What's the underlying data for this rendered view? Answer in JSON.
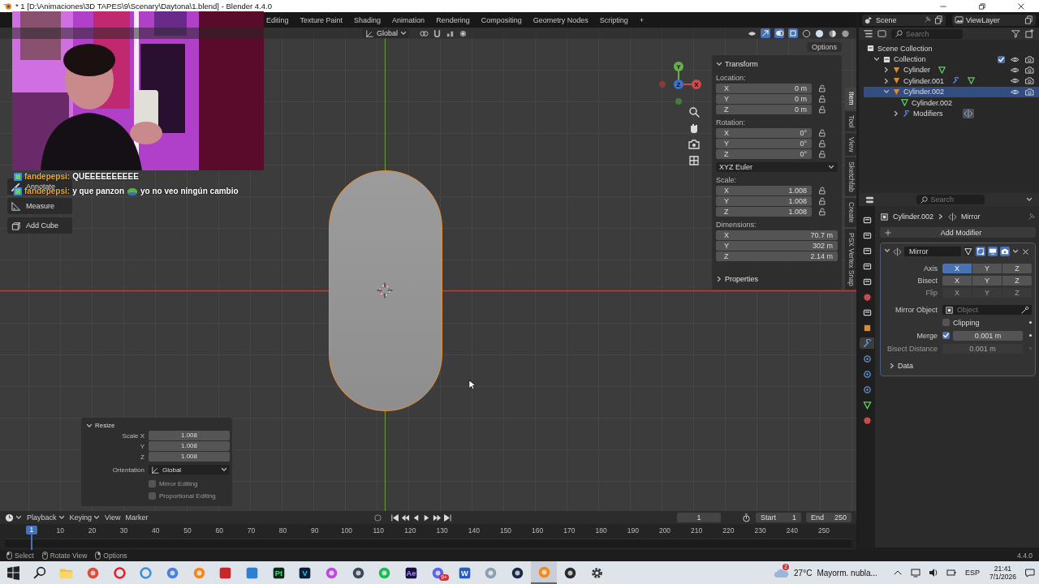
{
  "window": {
    "title": "* 1 [D:\\Animaciones\\3D TAPES\\9\\Scenary\\Daytona\\1.blend] - Blender 4.4.0"
  },
  "workspace_tabs": [
    {
      "label": "Editing"
    },
    {
      "label": "Texture Paint"
    },
    {
      "label": "Shading"
    },
    {
      "label": "Animation"
    },
    {
      "label": "Rendering"
    },
    {
      "label": "Compositing"
    },
    {
      "label": "Geometry Nodes"
    },
    {
      "label": "Scripting"
    },
    {
      "label": "+"
    }
  ],
  "scene": "Scene",
  "view_layer": "ViewLayer",
  "chat": [
    {
      "user": "fandepepsi:",
      "segments": [
        {
          "kind": "text",
          "text": "QUEEEEEEEEEE"
        }
      ]
    },
    {
      "user": "fandepepsi:",
      "segments": [
        {
          "kind": "text",
          "text": "y que panzon"
        },
        {
          "kind": "emote"
        },
        {
          "kind": "text",
          "text": "yo no veo ningún cambio"
        }
      ]
    }
  ],
  "viewport": {
    "orientation": "Global",
    "gizmo": {
      "x": "X",
      "y": "Y",
      "z": "Z"
    }
  },
  "toolbar": [
    {
      "label": "Annotate"
    },
    {
      "label": "Measure"
    },
    {
      "label": "Add Cube"
    }
  ],
  "n_panel": {
    "options": "Options",
    "tabs": [
      {
        "label": "Item",
        "selected": true
      },
      {
        "label": "Tool",
        "selected": false
      },
      {
        "label": "View",
        "selected": false
      },
      {
        "label": "Sketchfab",
        "selected": false
      },
      {
        "label": "Create",
        "selected": false
      },
      {
        "label": "PSX Vertex Snap",
        "selected": false
      }
    ],
    "transform": {
      "title": "Transform",
      "expanded": true,
      "items": [
        {
          "kind": "vector",
          "label": "Location:",
          "locks": true,
          "rows": [
            {
              "axis": "X",
              "value": "0 m"
            },
            {
              "axis": "Y",
              "value": "0 m"
            },
            {
              "axis": "Z",
              "value": "0 m"
            }
          ]
        },
        {
          "kind": "vector",
          "label": "Rotation:",
          "locks": true,
          "rows": [
            {
              "axis": "X",
              "value": "0°"
            },
            {
              "axis": "Y",
              "value": "0°"
            },
            {
              "axis": "Z",
              "value": "0°"
            }
          ]
        },
        {
          "kind": "dropdown",
          "value": "XYZ Euler"
        },
        {
          "kind": "vector",
          "label": "Scale:",
          "locks": true,
          "rows": [
            {
              "axis": "X",
              "value": "1.008"
            },
            {
              "axis": "Y",
              "value": "1.008"
            },
            {
              "axis": "Z",
              "value": "1.008"
            }
          ]
        },
        {
          "kind": "vector",
          "label": "Dimensions:",
          "locks": false,
          "rows": [
            {
              "axis": "X",
              "value": "70.7 m"
            },
            {
              "axis": "Y",
              "value": "302 m"
            },
            {
              "axis": "Z",
              "value": "2.14 m"
            }
          ]
        }
      ]
    },
    "properties": {
      "title": "Properties",
      "expanded": false
    }
  },
  "resize_panel": {
    "title": "Resize",
    "expanded": true,
    "fields": [
      {
        "label": "Scale X",
        "value": "1.008"
      },
      {
        "label": "Y",
        "value": "1.008"
      },
      {
        "label": "Z",
        "value": "1.008"
      }
    ],
    "orientation": {
      "label": "Orientation",
      "value": "Global"
    },
    "checks": [
      {
        "label": "Mirror Editing",
        "checked": false
      },
      {
        "label": "Proportional Editing",
        "checked": false
      }
    ]
  },
  "outliner": {
    "search_placeholder": "Search",
    "tree": [
      {
        "kind": "scene_collection",
        "label": "Scene Collection",
        "children": [
          {
            "kind": "collection",
            "label": "Collection",
            "expanded": true,
            "checked": true,
            "children": [
              {
                "kind": "object",
                "label": "Cylinder",
                "expanded": false,
                "selected": false,
                "modifier_icon": false
              },
              {
                "kind": "object",
                "label": "Cylinder.001",
                "expanded": false,
                "selected": false,
                "modifier_icon": true
              },
              {
                "kind": "object",
                "label": "Cylinder.002",
                "expanded": true,
                "selected": true,
                "modifier_icon": false,
                "children": [
                  {
                    "kind": "mesh",
                    "label": "Cylinder.002"
                  },
                  {
                    "kind": "modifiers",
                    "label": "Modifiers",
                    "expanded": false
                  }
                ]
              }
            ]
          }
        ]
      }
    ]
  },
  "properties": {
    "search_placeholder": "Search",
    "tabs": [
      {
        "kind": "tool",
        "selected": false
      },
      {
        "kind": "render",
        "selected": false
      },
      {
        "kind": "output",
        "selected": false
      },
      {
        "kind": "view_layer",
        "selected": false
      },
      {
        "kind": "scene",
        "selected": false
      },
      {
        "kind": "world",
        "selected": false
      },
      {
        "kind": "collection",
        "selected": false
      },
      {
        "kind": "object",
        "selected": false
      },
      {
        "kind": "modifier",
        "selected": true
      },
      {
        "kind": "particles",
        "selected": false
      },
      {
        "kind": "physics",
        "selected": false
      },
      {
        "kind": "constraints",
        "selected": false
      },
      {
        "kind": "data",
        "selected": false
      },
      {
        "kind": "material",
        "selected": false
      }
    ],
    "breadcrumb": [
      "Cylinder.002",
      "Mirror"
    ],
    "add_modifier": "Add Modifier",
    "modifier": {
      "name": "Mirror",
      "expanded": true,
      "toggles": [
        {
          "kind": "cage",
          "on": false
        },
        {
          "kind": "edit_mode",
          "on": true
        },
        {
          "kind": "viewport",
          "on": true
        },
        {
          "kind": "render",
          "on": true
        }
      ],
      "axis_rows": [
        {
          "label": "Axis",
          "disabled": false,
          "buttons": [
            {
              "label": "X",
              "selected": true
            },
            {
              "label": "Y",
              "selected": false
            },
            {
              "label": "Z",
              "selected": false
            }
          ]
        },
        {
          "label": "Bisect",
          "disabled": false,
          "buttons": [
            {
              "label": "X",
              "selected": false
            },
            {
              "label": "Y",
              "selected": false
            },
            {
              "label": "Z",
              "selected": false
            }
          ]
        },
        {
          "label": "Flip",
          "disabled": true,
          "buttons": [
            {
              "label": "X",
              "selected": false
            },
            {
              "label": "Y",
              "selected": false
            },
            {
              "label": "Z",
              "selected": false
            }
          ]
        }
      ],
      "mirror_object": {
        "label": "Mirror Object",
        "placeholder": "Object"
      },
      "clipping": {
        "label": "Clipping",
        "checked": false
      },
      "merge": {
        "label": "Merge",
        "checked": true,
        "value": "0.001 m"
      },
      "bisect_distance": {
        "label": "Bisect Distance",
        "value": "0.001 m",
        "disabled": true
      },
      "data": {
        "label": "Data",
        "expanded": false
      }
    }
  },
  "timeline": {
    "menus": [
      {
        "label": "Playback",
        "dropdown": true
      },
      {
        "label": "Keying",
        "dropdown": true
      },
      {
        "label": "View",
        "dropdown": false
      },
      {
        "label": "Marker",
        "dropdown": false
      }
    ],
    "current_frame": "1",
    "start": {
      "label": "Start",
      "value": "1"
    },
    "end": {
      "label": "End",
      "value": "250"
    },
    "playhead": "1",
    "ticks": [
      "10",
      "20",
      "30",
      "40",
      "50",
      "60",
      "70",
      "80",
      "90",
      "100",
      "110",
      "120",
      "130",
      "140",
      "150",
      "160",
      "170",
      "180",
      "190",
      "200",
      "210",
      "220",
      "230",
      "240",
      "250"
    ]
  },
  "status_bar": {
    "items": [
      {
        "kind": "left_click",
        "label": "Select"
      },
      {
        "kind": "middle_click",
        "label": "Rotate View"
      },
      {
        "kind": "right_click",
        "label": "Options"
      }
    ],
    "version": "4.4.0"
  },
  "taskbar": {
    "apps": [
      {
        "kind": "folder",
        "active": false
      },
      {
        "kind": "chrome",
        "active": false
      },
      {
        "kind": "opera",
        "active": false
      },
      {
        "kind": "ccleaner",
        "active": false
      },
      {
        "kind": "feather",
        "active": false
      },
      {
        "kind": "orange_eye",
        "active": false
      },
      {
        "kind": "voicemeeter",
        "active": false
      },
      {
        "kind": "photos",
        "active": false
      },
      {
        "kind": "pt",
        "glyph": "Pt",
        "active": false
      },
      {
        "kind": "vegas",
        "glyph": "V",
        "active": false
      },
      {
        "kind": "affinity",
        "active": false
      },
      {
        "kind": "davinci",
        "active": false
      },
      {
        "kind": "spotify",
        "active": false
      },
      {
        "kind": "ae",
        "glyph": "Ae",
        "active": false
      },
      {
        "kind": "discord",
        "badge": "9+",
        "active": false
      },
      {
        "kind": "word",
        "glyph": "W",
        "active": false
      },
      {
        "kind": "paint",
        "active": false
      },
      {
        "kind": "steam",
        "active": false
      },
      {
        "kind": "blender",
        "active": true
      },
      {
        "kind": "obs",
        "active": false
      },
      {
        "kind": "settings",
        "active": false
      }
    ],
    "weather": {
      "temp": "27°C",
      "text": "Mayorm. nubla...",
      "badge": "2"
    },
    "language": "ESP",
    "time": "21:41",
    "date": "7/1/2026"
  }
}
